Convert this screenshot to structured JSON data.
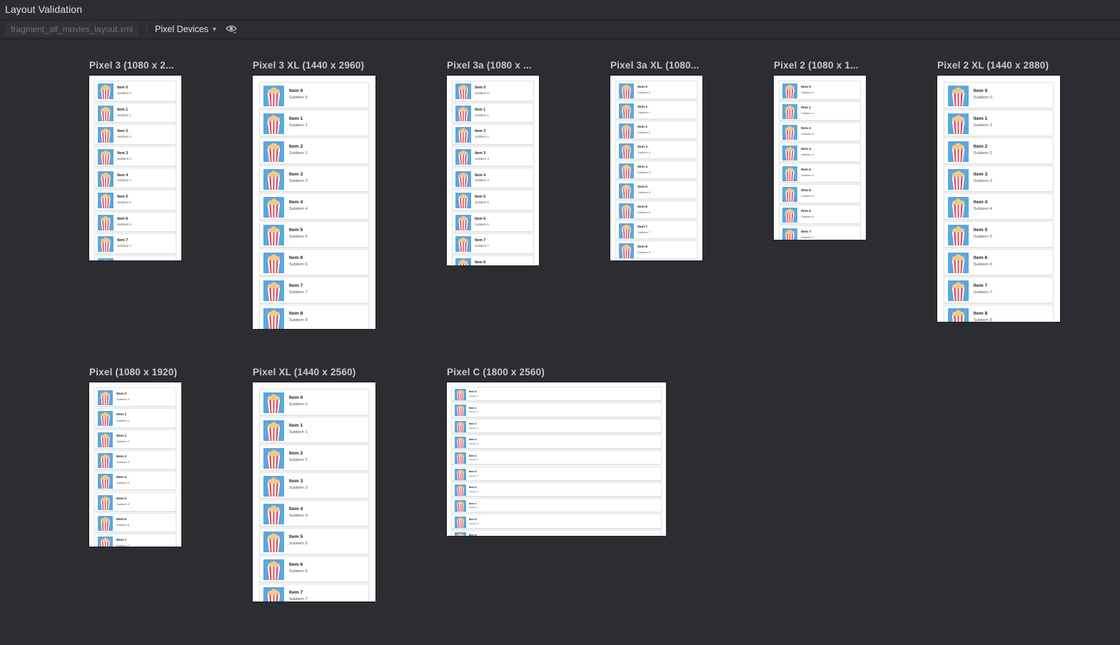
{
  "window": {
    "title": "Layout Validation"
  },
  "toolbar": {
    "file_name": "fragment_all_movies_layout.xml",
    "device_group": "Pixel Devices",
    "chevron_icon": "chevron-down-icon",
    "visibility_icon": "eye-icon"
  },
  "colors": {
    "poster_bg": "#5ba7df",
    "stripe_red": "#e8464f",
    "popcorn": "#f2c98a",
    "canvas_bg": "#2b2d30"
  },
  "devices": [
    {
      "label": "Pixel 3 (1080 x 2...",
      "items": [
        {
          "title": "Item 0",
          "subtitle": "Subitem 0"
        },
        {
          "title": "Item 1",
          "subtitle": "Subitem 1"
        },
        {
          "title": "Item 2",
          "subtitle": "Subitem 2"
        },
        {
          "title": "Item 3",
          "subtitle": "Subitem 3"
        },
        {
          "title": "Item 4",
          "subtitle": "Subitem 4"
        },
        {
          "title": "Item 5",
          "subtitle": "Subitem 5"
        },
        {
          "title": "Item 6",
          "subtitle": "Subitem 6"
        },
        {
          "title": "Item 7",
          "subtitle": "Subitem 7"
        },
        {
          "title": "",
          "subtitle": ""
        }
      ]
    },
    {
      "label": "Pixel 3 XL (1440 x 2960)",
      "items": [
        {
          "title": "Item 0",
          "subtitle": "Subitem 0"
        },
        {
          "title": "Item 1",
          "subtitle": "Subitem 1"
        },
        {
          "title": "Item 2",
          "subtitle": "Subitem 2"
        },
        {
          "title": "Item 3",
          "subtitle": "Subitem 3"
        },
        {
          "title": "Item 4",
          "subtitle": "Subitem 4"
        },
        {
          "title": "Item 5",
          "subtitle": "Subitem 5"
        },
        {
          "title": "Item 6",
          "subtitle": "Subitem 6"
        },
        {
          "title": "Item 7",
          "subtitle": "Subitem 7"
        },
        {
          "title": "Item 8",
          "subtitle": "Subitem 8"
        }
      ]
    },
    {
      "label": "Pixel 3a (1080 x ...",
      "items": [
        {
          "title": "Item 0",
          "subtitle": "Subitem 0"
        },
        {
          "title": "Item 1",
          "subtitle": "Subitem 1"
        },
        {
          "title": "Item 2",
          "subtitle": "Subitem 2"
        },
        {
          "title": "Item 3",
          "subtitle": "Subitem 3"
        },
        {
          "title": "Item 4",
          "subtitle": "Subitem 4"
        },
        {
          "title": "Item 5",
          "subtitle": "Subitem 5"
        },
        {
          "title": "Item 6",
          "subtitle": "Subitem 6"
        },
        {
          "title": "Item 7",
          "subtitle": "Subitem 7"
        },
        {
          "title": "Item 8",
          "subtitle": ""
        }
      ]
    },
    {
      "label": "Pixel 3a XL (1080...",
      "items": [
        {
          "title": "Item 0",
          "subtitle": "Subitem 0"
        },
        {
          "title": "Item 1",
          "subtitle": "Subitem 1"
        },
        {
          "title": "Item 2",
          "subtitle": "Subitem 2"
        },
        {
          "title": "Item 3",
          "subtitle": "Subitem 3"
        },
        {
          "title": "Item 4",
          "subtitle": "Subitem 4"
        },
        {
          "title": "Item 5",
          "subtitle": "Subitem 5"
        },
        {
          "title": "Item 6",
          "subtitle": "Subitem 6"
        },
        {
          "title": "Item 7",
          "subtitle": "Subitem 7"
        },
        {
          "title": "Item 8",
          "subtitle": "Subitem 8"
        }
      ]
    },
    {
      "label": "Pixel 2 (1080 x 1...",
      "items": [
        {
          "title": "Item 0",
          "subtitle": "Subitem 0"
        },
        {
          "title": "Item 1",
          "subtitle": "Subitem 1"
        },
        {
          "title": "Item 2",
          "subtitle": "Subitem 2"
        },
        {
          "title": "Item 3",
          "subtitle": "Subitem 3"
        },
        {
          "title": "Item 4",
          "subtitle": "Subitem 4"
        },
        {
          "title": "Item 5",
          "subtitle": "Subitem 5"
        },
        {
          "title": "Item 6",
          "subtitle": "Subitem 6"
        },
        {
          "title": "Item 7",
          "subtitle": "Subitem 7"
        }
      ]
    },
    {
      "label": "Pixel 2 XL (1440 x 2880)",
      "items": [
        {
          "title": "Item 0",
          "subtitle": "Subitem 0"
        },
        {
          "title": "Item 1",
          "subtitle": "Subitem 1"
        },
        {
          "title": "Item 2",
          "subtitle": "Subitem 2"
        },
        {
          "title": "Item 3",
          "subtitle": "Subitem 3"
        },
        {
          "title": "Item 4",
          "subtitle": "Subitem 4"
        },
        {
          "title": "Item 5",
          "subtitle": "Subitem 5"
        },
        {
          "title": "Item 6",
          "subtitle": "Subitem 6"
        },
        {
          "title": "Item 7",
          "subtitle": "Subitem 7"
        },
        {
          "title": "Item 8",
          "subtitle": "Subitem 8"
        }
      ]
    },
    {
      "label": "Pixel (1080 x 1920)",
      "items": [
        {
          "title": "Item 0",
          "subtitle": "Subitem 0"
        },
        {
          "title": "Item 1",
          "subtitle": "Subitem 1"
        },
        {
          "title": "Item 2",
          "subtitle": "Subitem 2"
        },
        {
          "title": "Item 3",
          "subtitle": "Subitem 3"
        },
        {
          "title": "Item 4",
          "subtitle": "Subitem 4"
        },
        {
          "title": "Item 5",
          "subtitle": "Subitem 5"
        },
        {
          "title": "Item 6",
          "subtitle": "Subitem 6"
        },
        {
          "title": "Item 7",
          "subtitle": "Subitem 7"
        }
      ]
    },
    {
      "label": "Pixel XL (1440 x 2560)",
      "items": [
        {
          "title": "Item 0",
          "subtitle": "Subitem 0"
        },
        {
          "title": "Item 1",
          "subtitle": "Subitem 1"
        },
        {
          "title": "Item 2",
          "subtitle": "Subitem 2"
        },
        {
          "title": "Item 3",
          "subtitle": "Subitem 3"
        },
        {
          "title": "Item 4",
          "subtitle": "Subitem 4"
        },
        {
          "title": "Item 5",
          "subtitle": "Subitem 5"
        },
        {
          "title": "Item 6",
          "subtitle": "Subitem 6"
        },
        {
          "title": "Item 7",
          "subtitle": "Subitem 7"
        }
      ]
    },
    {
      "label": "Pixel C (1800 x 2560)",
      "items": [
        {
          "title": "Item 0",
          "subtitle": "Subitem 0"
        },
        {
          "title": "Item 1",
          "subtitle": "Subitem 1"
        },
        {
          "title": "Item 2",
          "subtitle": "Subitem 2"
        },
        {
          "title": "Item 3",
          "subtitle": "Subitem 3"
        },
        {
          "title": "Item 4",
          "subtitle": "Subitem 4"
        },
        {
          "title": "Item 5",
          "subtitle": "Subitem 5"
        },
        {
          "title": "Item 6",
          "subtitle": "Subitem 6"
        },
        {
          "title": "Item 7",
          "subtitle": "Subitem 7"
        },
        {
          "title": "Item 8",
          "subtitle": "Subitem 8"
        },
        {
          "title": "Item 9",
          "subtitle": ""
        }
      ]
    }
  ]
}
